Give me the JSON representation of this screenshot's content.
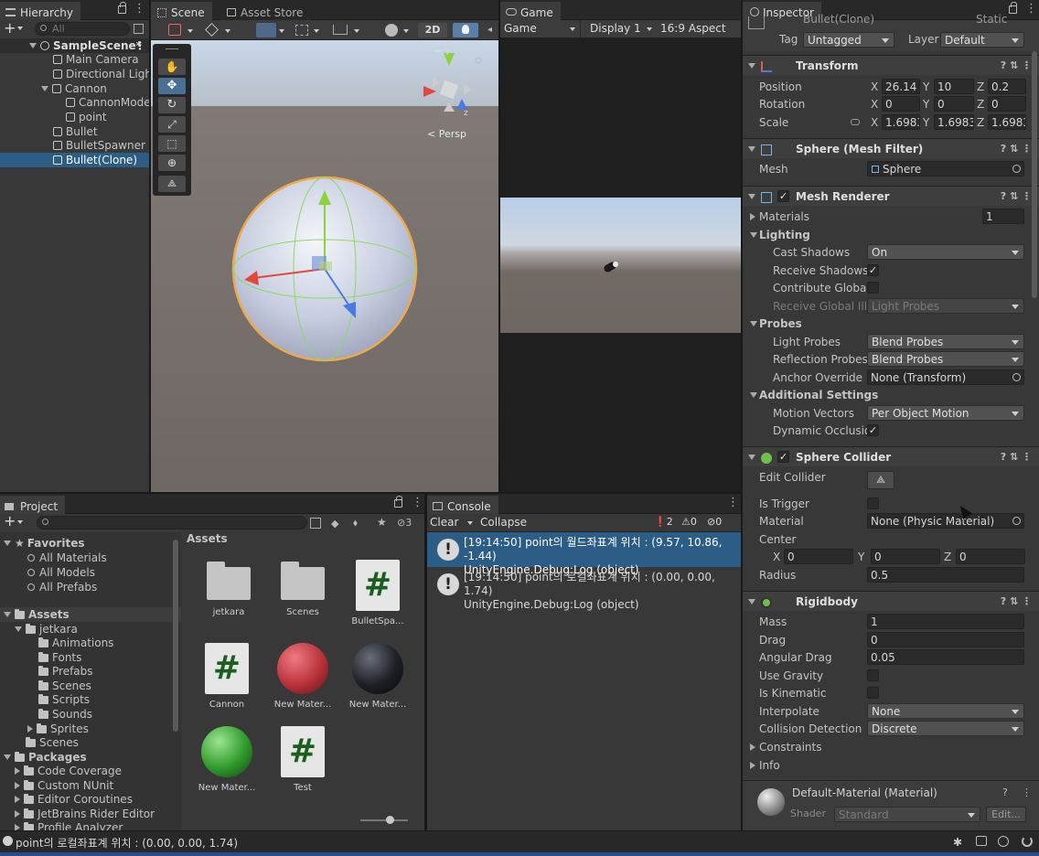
{
  "hierarchy": {
    "tab": "Hierarchy",
    "search_placeholder": "All",
    "items": [
      {
        "label": "SampleScene*"
      },
      {
        "label": "Main Camera"
      },
      {
        "label": "Directional Light"
      },
      {
        "label": "Cannon"
      },
      {
        "label": "CannonMode"
      },
      {
        "label": "point"
      },
      {
        "label": "Bullet"
      },
      {
        "label": "BulletSpawner"
      },
      {
        "label": "Bullet(Clone)"
      }
    ]
  },
  "scene": {
    "tab_scene": "Scene",
    "tab_asset_store": "Asset Store",
    "mode_2d": "2D",
    "gizmo_label": "< Persp",
    "gizmo_axis_y": "y",
    "gizmo_axis_z": "z"
  },
  "game": {
    "tab": "Game",
    "display_dropdown": "Game",
    "display": "Display 1",
    "aspect": "16:9 Aspect"
  },
  "inspector": {
    "tab": "Inspector",
    "object_name": "Bullet(Clone)",
    "static_label": "Static",
    "tag_label": "Tag",
    "tag_value": "Untagged",
    "layer_label": "Layer",
    "layer_value": "Default",
    "transform": {
      "title": "Transform",
      "position_label": "Position",
      "rotation_label": "Rotation",
      "scale_label": "Scale",
      "position": {
        "x": "26.14",
        "y": "10",
        "z": "0.2"
      },
      "rotation": {
        "x": "0",
        "y": "0",
        "z": "0"
      },
      "scale": {
        "x": "1.6983",
        "y": "1.6983",
        "z": "1.6983"
      },
      "axis_x": "X",
      "axis_y": "Y",
      "axis_z": "Z"
    },
    "mesh_filter": {
      "title": "Sphere (Mesh Filter)",
      "mesh_label": "Mesh",
      "mesh_value": "Sphere"
    },
    "mesh_renderer": {
      "title": "Mesh Renderer",
      "materials_label": "Materials",
      "materials_count": "1",
      "lighting_label": "Lighting",
      "cast_shadows_label": "Cast Shadows",
      "cast_shadows_value": "On",
      "receive_shadows_label": "Receive Shadows",
      "contribute_gi_label": "Contribute Global I",
      "receive_gi_label": "Receive Global Illu",
      "receive_gi_value": "Light Probes",
      "probes_label": "Probes",
      "light_probes_label": "Light Probes",
      "light_probes_value": "Blend Probes",
      "reflection_probes_label": "Reflection Probes",
      "reflection_probes_value": "Blend Probes",
      "anchor_override_label": "Anchor Override",
      "anchor_override_value": "None (Transform)",
      "additional_label": "Additional Settings",
      "motion_vectors_label": "Motion Vectors",
      "motion_vectors_value": "Per Object Motion",
      "dynamic_occlusion_label": "Dynamic Occlusio"
    },
    "sphere_collider": {
      "title": "Sphere Collider",
      "edit_collider_label": "Edit Collider",
      "is_trigger_label": "Is Trigger",
      "material_label": "Material",
      "material_value": "None (Physic Material)",
      "center_label": "Center",
      "center": {
        "x": "0",
        "y": "0",
        "z": "0"
      },
      "radius_label": "Radius",
      "radius_value": "0.5"
    },
    "rigidbody": {
      "title": "Rigidbody",
      "mass_label": "Mass",
      "mass_value": "1",
      "drag_label": "Drag",
      "drag_value": "0",
      "angular_drag_label": "Angular Drag",
      "angular_drag_value": "0.05",
      "use_gravity_label": "Use Gravity",
      "is_kinematic_label": "Is Kinematic",
      "interpolate_label": "Interpolate",
      "interpolate_value": "None",
      "collision_detection_label": "Collision Detection",
      "collision_detection_value": "Discrete",
      "constraints_label": "Constraints",
      "info_label": "Info"
    },
    "material": {
      "title": "Default-Material (Material)",
      "shader_label": "Shader",
      "shader_value": "Standard",
      "edit_label": "Edit..."
    }
  },
  "project": {
    "tab": "Project",
    "favorites_label": "Favorites",
    "favorites": [
      "All Materials",
      "All Models",
      "All Prefabs"
    ],
    "assets_label": "Assets",
    "tree": [
      "jetkara",
      "Animations",
      "Fonts",
      "Prefabs",
      "Scenes",
      "Scripts",
      "Sounds",
      "Sprites",
      "Scenes"
    ],
    "packages_label": "Packages",
    "packages": [
      "Code Coverage",
      "Custom NUnit",
      "Editor Coroutines",
      "JetBrains Rider Editor",
      "Profile Analyzer"
    ],
    "hidden_count": "3",
    "grid_title": "Assets",
    "grid": [
      {
        "label": "jetkara",
        "kind": "folder"
      },
      {
        "label": "Scenes",
        "kind": "folder"
      },
      {
        "label": "BulletSpa...",
        "kind": "script"
      },
      {
        "label": "Cannon",
        "kind": "script"
      },
      {
        "label": "New Mater...",
        "kind": "material",
        "color": "#b8323a"
      },
      {
        "label": "New Mater...",
        "kind": "material",
        "color": "#1d1f24"
      },
      {
        "label": "New Mater...",
        "kind": "material",
        "color": "#2f9a2c"
      },
      {
        "label": "Test",
        "kind": "script"
      }
    ]
  },
  "console": {
    "tab": "Console",
    "clear_label": "Clear",
    "collapse_label": "Collapse",
    "info_count": "2",
    "warn_count": "0",
    "error_count": "0",
    "logs": [
      {
        "line1": "[19:14:50] point의 월드좌표계 위치 : (9.57, 10.86, -1.44)",
        "line2": "UnityEngine.Debug:Log (object)"
      },
      {
        "line1": "[19:14:50] point의 로컬좌표계 위치 : (0.00, 0.00, 1.74)",
        "line2": "UnityEngine.Debug:Log (object)"
      }
    ]
  },
  "status_bar": {
    "message": "point의 로컬좌표계 위치 : (0.00, 0.00, 1.74)"
  },
  "colors": {
    "selection": "#2c5d87",
    "panel": "#383838",
    "tabbar": "#282828"
  }
}
